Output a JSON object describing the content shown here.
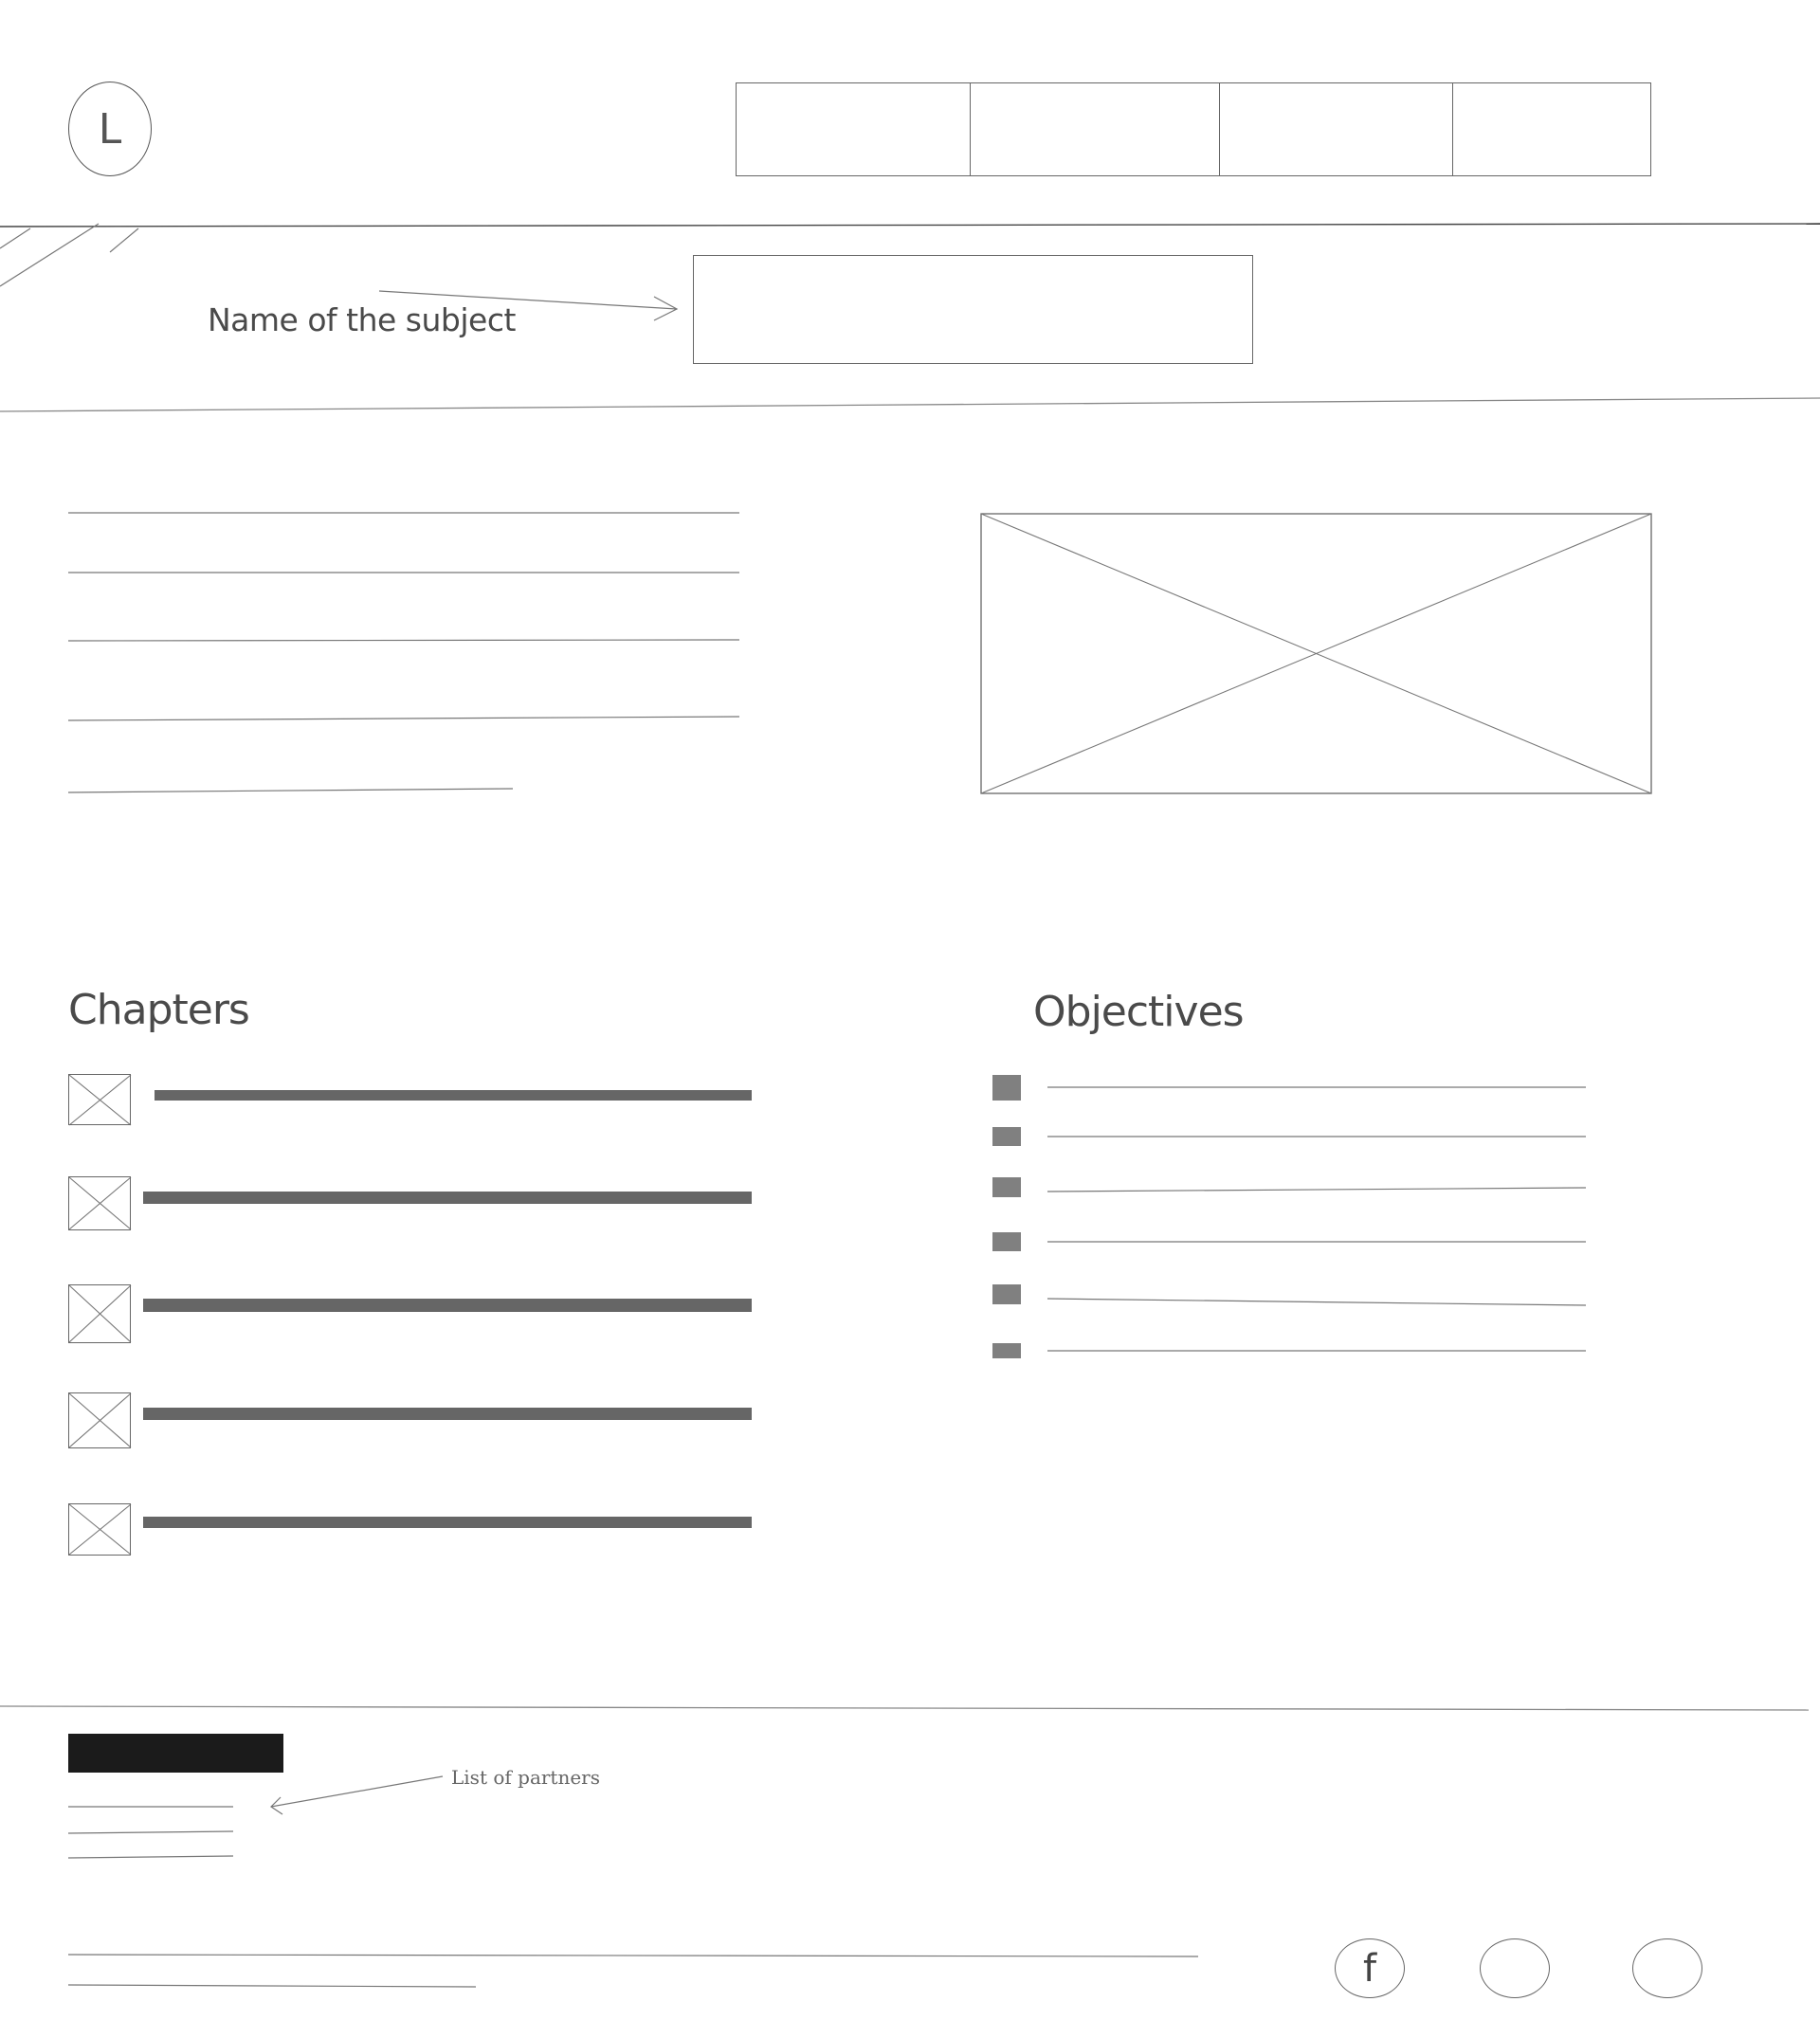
{
  "header": {
    "logo_letter": "L",
    "nav_items": [
      "",
      "",
      "",
      ""
    ]
  },
  "subject": {
    "label": "Name of the subject",
    "input_value": ""
  },
  "intro": {
    "text_lines": 5,
    "image": "placeholder-image"
  },
  "chapters": {
    "title": "Chapters",
    "items": 5,
    "thumbnail": "placeholder-image"
  },
  "objectives": {
    "title": "Objectives",
    "items": 6
  },
  "footer": {
    "partners_note": "List of partners",
    "social_icons": [
      "facebook-icon",
      "social-icon",
      "social-icon"
    ],
    "facebook_glyph": "f"
  },
  "colors": {
    "line": "#666666",
    "bar": "#666666",
    "bullet": "#808080",
    "block": "#1b1b1b"
  }
}
